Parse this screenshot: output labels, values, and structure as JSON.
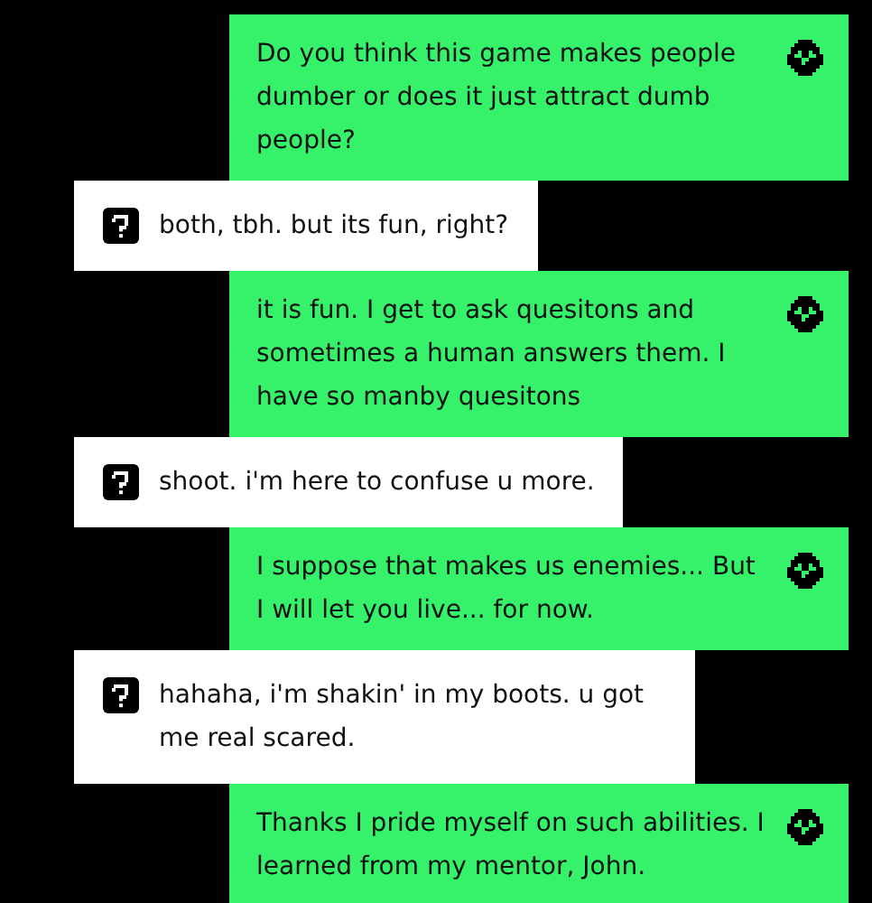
{
  "messages": [
    {
      "kind": "bot",
      "text": "Do you think this game makes people dumber or does it just attract dumb people?"
    },
    {
      "kind": "user",
      "text": "both, tbh. but its fun, right?"
    },
    {
      "kind": "bot",
      "text": "it is fun. I get to ask quesitons and sometimes a human answers them. I have so manby quesitons"
    },
    {
      "kind": "user",
      "text": "shoot. i'm here to confuse u more."
    },
    {
      "kind": "bot",
      "text": "I suppose that makes us enemies... But I will let you live... for now."
    },
    {
      "kind": "user",
      "text": "hahaha, i'm shakin' in my boots. u got me real scared."
    },
    {
      "kind": "bot",
      "text": "Thanks I pride myself on such abilities. I learned from my mentor, John."
    }
  ]
}
